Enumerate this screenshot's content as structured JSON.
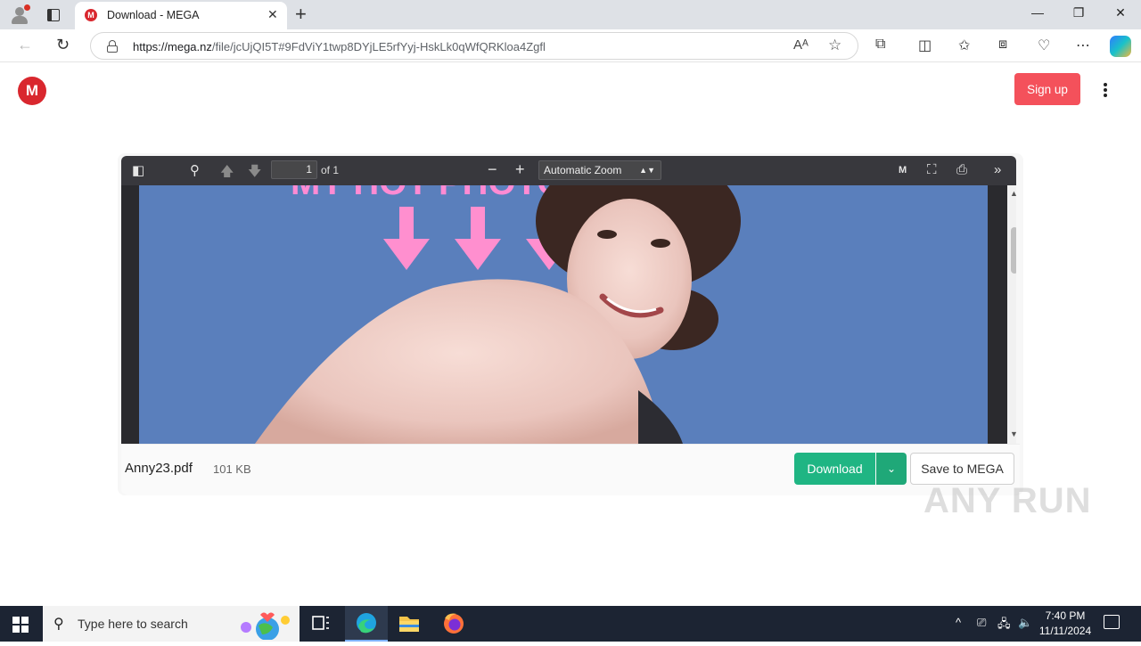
{
  "browser": {
    "tab_title": "Download - MEGA",
    "tab_favicon": "M",
    "url_host": "https://mega.nz",
    "url_path": "/file/jcUjQI5T#9FdViY1twp8DYjLE5rfYyj-HskLk0qWfQRKloa4Zgfl",
    "new_tab_label": "+",
    "close_tab_label": "✕",
    "minimize_label": "—",
    "restore_label": "❐",
    "close_window_label": "✕"
  },
  "mega": {
    "logo_letter": "M",
    "signup_label": "Sign up",
    "brand_color": "#d9272e",
    "signup_color": "#f4515b"
  },
  "pdf_viewer": {
    "page_number": "1",
    "page_of": "of 1",
    "zoom": "Automatic Zoom",
    "page_banner_text": "MY HOT PHOTOS"
  },
  "file": {
    "name": "Anny23.pdf",
    "size": "101 KB",
    "download_label": "Download",
    "save_label": "Save to MEGA",
    "download_color": "#1fb583"
  },
  "watermark": "ANY RUN",
  "taskbar": {
    "search_placeholder": "Type here to search",
    "time": "7:40 PM",
    "date": "11/11/2024"
  }
}
